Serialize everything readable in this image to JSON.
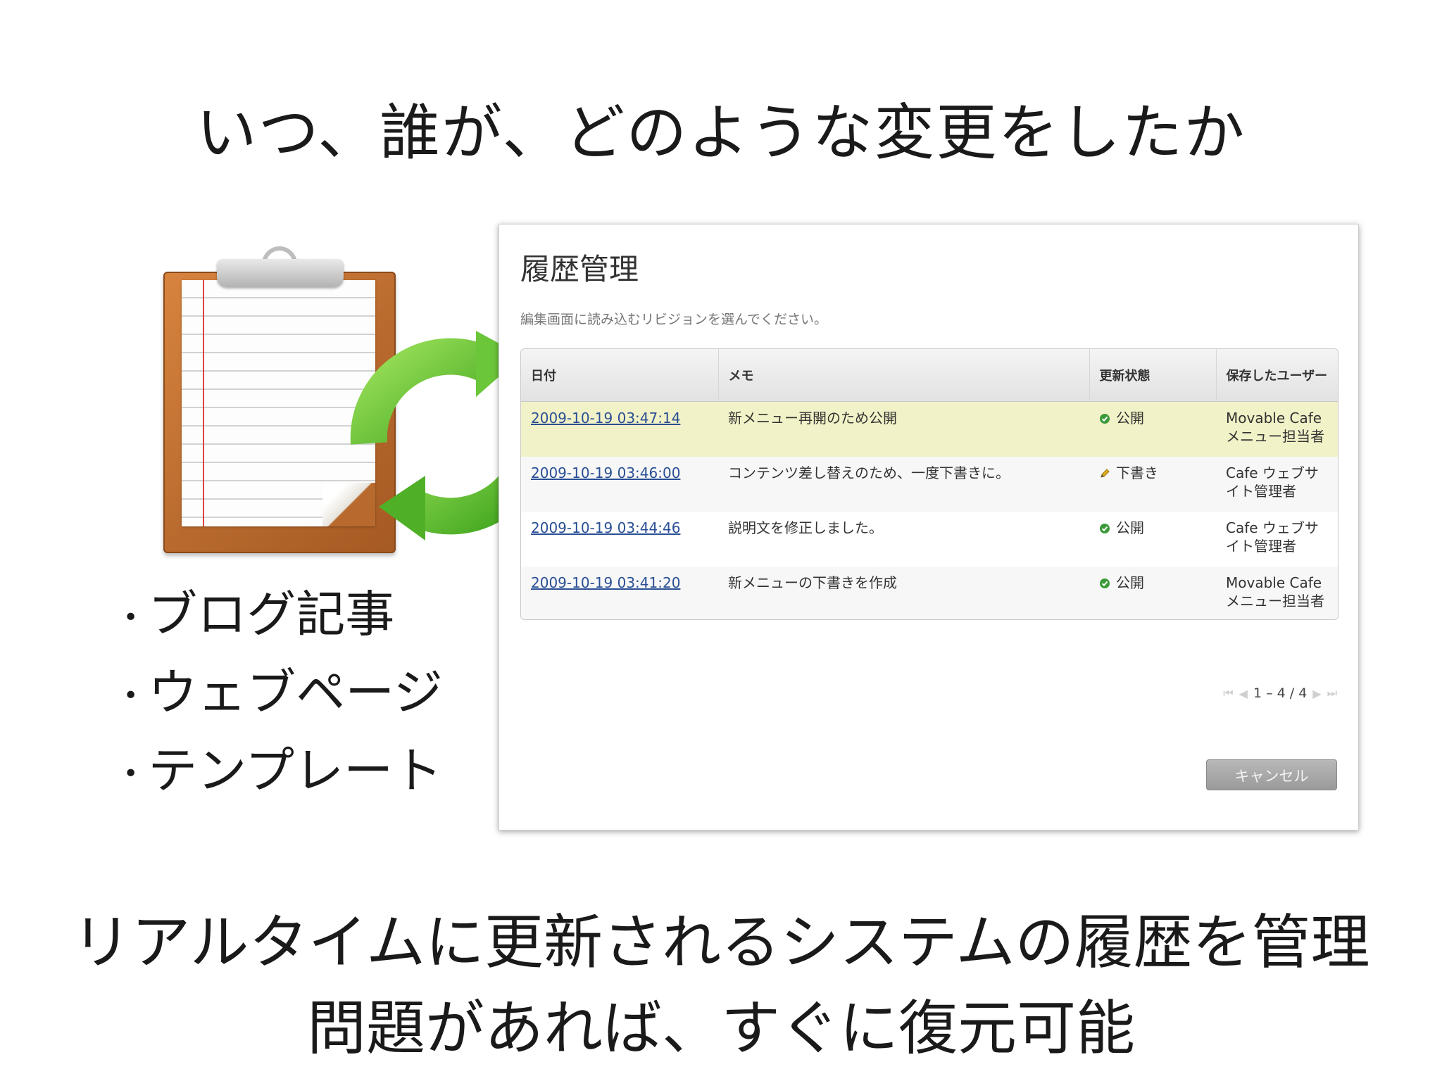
{
  "slide": {
    "title": "いつ、誰が、どのような変更をしたか",
    "bullets": [
      "ブログ記事",
      "ウェブページ",
      "テンプレート"
    ],
    "bottom_line_1": "リアルタイムに更新されるシステムの履歴を管理",
    "bottom_line_2": "問題があれば、すぐに復元可能",
    "bullet_mark": "•"
  },
  "panel": {
    "title": "履歴管理",
    "subtitle": "編集画面に読み込むリビジョンを選んでください。",
    "columns": {
      "date": "日付",
      "memo": "メモ",
      "status": "更新状態",
      "user": "保存したユーザー"
    },
    "rows": [
      {
        "date": "2009-10-19 03:47:14",
        "memo": "新メニュー再開のため公開",
        "status": "公開",
        "status_icon": "check-icon",
        "user": "Movable Cafe メニュー担当者"
      },
      {
        "date": "2009-10-19 03:46:00",
        "memo": "コンテンツ差し替えのため、一度下書きに。",
        "status": "下書き",
        "status_icon": "pencil-icon",
        "user": "Cafe ウェブサイト管理者"
      },
      {
        "date": "2009-10-19 03:44:46",
        "memo": "説明文を修正しました。",
        "status": "公開",
        "status_icon": "check-icon",
        "user": "Cafe ウェブサイト管理者"
      },
      {
        "date": "2009-10-19 03:41:20",
        "memo": "新メニューの下書きを作成",
        "status": "公開",
        "status_icon": "check-icon",
        "user": "Movable Cafe メニュー担当者"
      }
    ],
    "pager": "1 – 4 / 4",
    "cancel_label": "キャンセル"
  },
  "colors": {
    "highlight_row": "#f2f2c8",
    "link": "#2a4f94",
    "publish_green": "#3a9a3a",
    "sync_green": "#5cbf2a",
    "clipboard_brown": "#b86a2e"
  }
}
